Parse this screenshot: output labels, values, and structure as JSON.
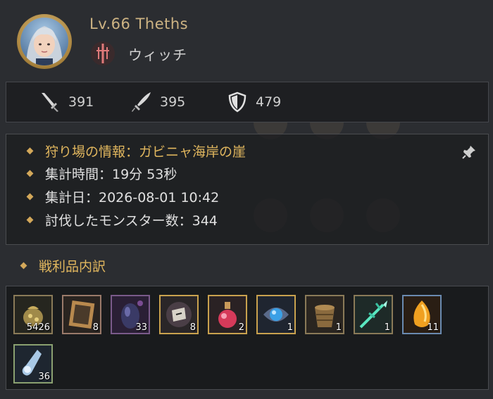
{
  "header": {
    "level_name": "Lv.66 Theths",
    "class_name": "ウィッチ"
  },
  "stats": [
    {
      "icon": "sword-icon",
      "value": "391"
    },
    {
      "icon": "dagger-icon",
      "value": "395"
    },
    {
      "icon": "shield-icon",
      "value": "479"
    }
  ],
  "info": {
    "hunting_ground": "狩り場の情報：ガビニャ海岸の崖",
    "tally_time": "集計時間：19分 53秒",
    "tally_date": "集計日：2026-08-01 10:42",
    "monsters": "討伐したモンスター数：344"
  },
  "loot": {
    "title": "戦利品内訳",
    "items": [
      {
        "name": "gold-pouch-icon",
        "qty": "5426",
        "border": "#8a7a58"
      },
      {
        "name": "mirror-frame-icon",
        "qty": "8",
        "border": "#9a7a6a"
      },
      {
        "name": "dark-egg-icon",
        "qty": "33",
        "border": "#7a5a8a"
      },
      {
        "name": "scroll-orb-icon",
        "qty": "8",
        "border": "#c9a24e"
      },
      {
        "name": "red-potion-icon",
        "qty": "2",
        "border": "#c9a24e"
      },
      {
        "name": "blue-gem-icon",
        "qty": "1",
        "border": "#c9a24e"
      },
      {
        "name": "bucket-icon",
        "qty": "1",
        "border": "#8a7a58"
      },
      {
        "name": "green-spear-icon",
        "qty": "1",
        "border": "#8a7a58"
      },
      {
        "name": "orange-crystal-icon",
        "qty": "11",
        "border": "#6a8ab0"
      },
      {
        "name": "potion-flask-icon",
        "qty": "36",
        "border": "#8aa070"
      }
    ]
  },
  "colors": {
    "accent_gold": "#e0b65e",
    "background": "#2b2d31"
  }
}
